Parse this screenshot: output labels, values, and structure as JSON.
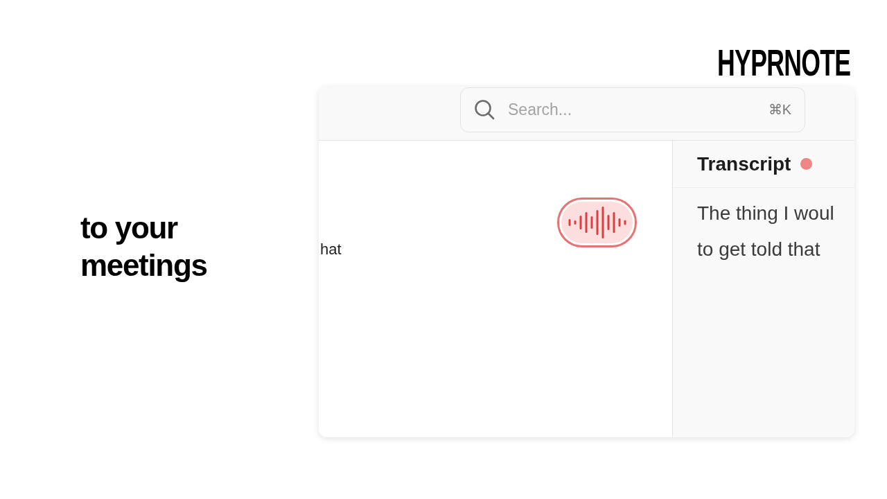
{
  "logo": {
    "text": "HYPRNOTE"
  },
  "headline": "to your meetings",
  "app": {
    "search": {
      "placeholder": "Search...",
      "shortcut": "⌘K"
    },
    "editor": {
      "fragment": "hat",
      "record_button": {
        "active": true
      }
    },
    "transcript": {
      "title": "Transcript",
      "live": true,
      "lines": [
        "The thing I woul",
        "to get told that"
      ]
    }
  }
}
